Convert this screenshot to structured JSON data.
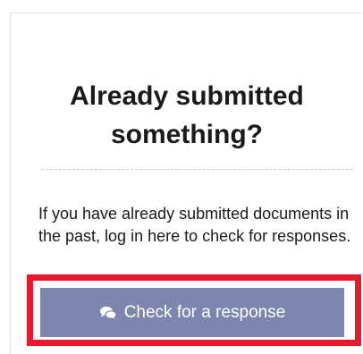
{
  "panel": {
    "title": "Already submitted something?",
    "body": "If you have already submitted documents in the past, log in here to check for responses.",
    "button": {
      "label": "Check for a response",
      "icon": "comments-icon"
    }
  },
  "colors": {
    "button_bg": "#7d87ad",
    "highlight_border": "#e8192c",
    "text": "#1a1a1a"
  }
}
